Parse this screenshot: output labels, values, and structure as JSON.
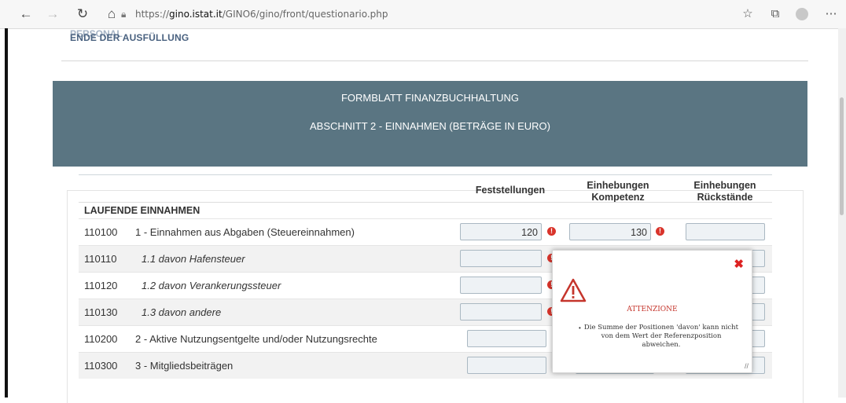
{
  "browser": {
    "url_prefix": "https://",
    "url_host": "gino.istat.it",
    "url_path": "/GINO6/gino/front/questionario.php"
  },
  "page": {
    "top_link": "ENDE DER AUSFÜLLUNG",
    "top_link_overlap": "PERSONAL",
    "banner_title": "FORMBLATT FINANZBUCHHALTUNG",
    "banner_subtitle": "ABSCHNITT 2 - EINNAHMEN (BETRÄGE IN EURO)"
  },
  "table": {
    "headers": {
      "col1": "Feststellungen",
      "col2_line1": "Einhebungen",
      "col2_line2": "Kompetenz",
      "col3_line1": "Einhebungen",
      "col3_line2": "Rückstände"
    },
    "section": "LAUFENDE EINNAHMEN",
    "rows": [
      {
        "code": "110100",
        "desc": "1 - Einnahmen aus Abgaben (Steuereinnahmen)",
        "v1": "120",
        "v2": "130",
        "v3": ""
      },
      {
        "code": "110110",
        "desc": "1.1 davon Hafensteuer",
        "v1": "",
        "v2": "",
        "v3": ""
      },
      {
        "code": "110120",
        "desc": "1.2 davon Verankerungssteuer",
        "v1": "",
        "v2": "",
        "v3": ""
      },
      {
        "code": "110130",
        "desc": "1.3 davon andere",
        "v1": "",
        "v2": "",
        "v3": ""
      },
      {
        "code": "110200",
        "desc": "2 - Aktive Nutzungsentgelte und/oder Nutzungsrechte",
        "v1": "",
        "v2": "",
        "v3": ""
      },
      {
        "code": "110300",
        "desc": "3 - Mitgliedsbeiträgen",
        "v1": "",
        "v2": "",
        "v3": ""
      }
    ]
  },
  "popup": {
    "title": "ATTENZIONE",
    "message": "Die Summe der Positionen 'davon' kann nicht von dem Wert der Referenzposition abweichen.",
    "close_symbol": "✖"
  },
  "colors": {
    "banner": "#5a7582",
    "warning": "#d9342b",
    "link": "#4a6280"
  }
}
